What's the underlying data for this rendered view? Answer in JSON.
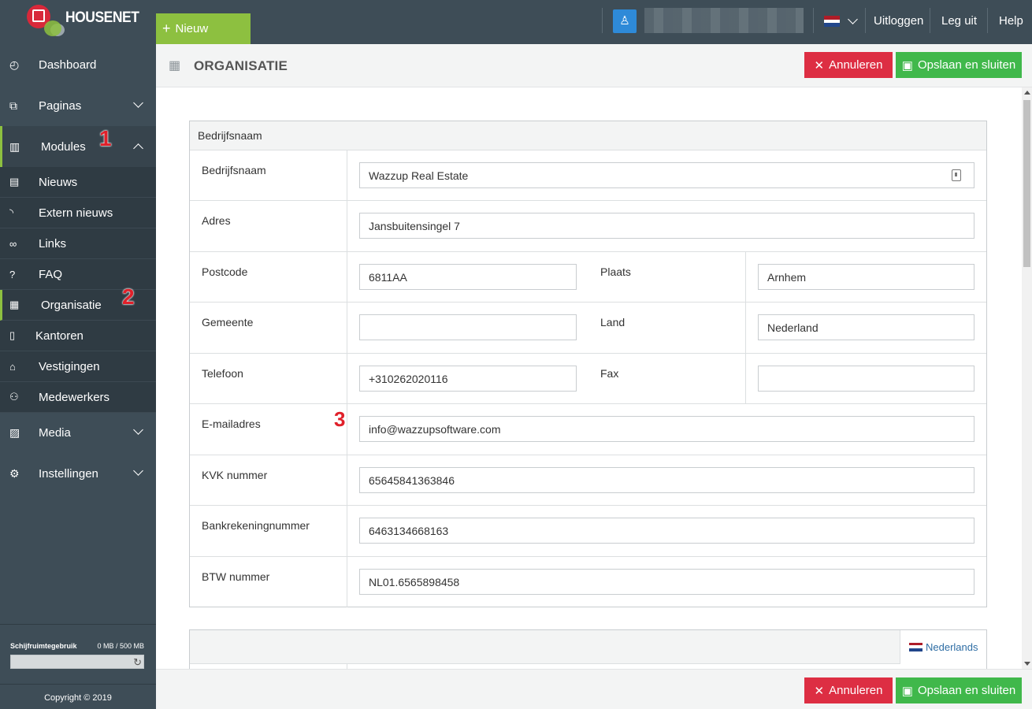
{
  "brand": {
    "name": "HOUSENET"
  },
  "topbar": {
    "new_label": "Nieuw",
    "links": [
      "Uitloggen",
      "Leg uit",
      "Help"
    ]
  },
  "sidebar": {
    "items": [
      {
        "label": "Dashboard",
        "icon": "dashboard-icon"
      },
      {
        "label": "Paginas",
        "icon": "sitemap-icon"
      },
      {
        "label": "Modules",
        "icon": "columns-icon"
      }
    ],
    "subitems": [
      {
        "label": "Nieuws",
        "icon": "newspaper-icon"
      },
      {
        "label": "Extern nieuws",
        "icon": "rss-icon"
      },
      {
        "label": "Links",
        "icon": "link-icon"
      },
      {
        "label": "FAQ",
        "icon": "question-icon"
      },
      {
        "label": "Organisatie",
        "icon": "city-icon"
      },
      {
        "label": "Kantoren",
        "icon": "building-icon"
      },
      {
        "label": "Vestigingen",
        "icon": "home-icon"
      },
      {
        "label": "Medewerkers",
        "icon": "users-icon"
      }
    ],
    "bottom_items": [
      {
        "label": "Media",
        "icon": "image-icon"
      },
      {
        "label": "Instellingen",
        "icon": "cogs-icon"
      }
    ],
    "markers": [
      "1",
      "2"
    ],
    "disk": {
      "label": "Schijfruimtegebruik",
      "value": "0 MB / 500 MB"
    },
    "copyright": "Copyright © 2019"
  },
  "page": {
    "title": "ORGANISATIE",
    "cancel_label": "Annuleren",
    "save_label": "Opslaan en sluiten",
    "marker3": "3"
  },
  "form": {
    "section_title": "Bedrijfsnaam",
    "bedrijfsnaam": {
      "label": "Bedrijfsnaam",
      "value": "Wazzup Real Estate"
    },
    "adres": {
      "label": "Adres",
      "value": "Jansbuitensingel 7"
    },
    "postcode": {
      "label": "Postcode",
      "value": "6811AA"
    },
    "plaats": {
      "label": "Plaats",
      "value": "Arnhem"
    },
    "gemeente": {
      "label": "Gemeente",
      "value": ""
    },
    "land": {
      "label": "Land",
      "value": "Nederland"
    },
    "telefoon": {
      "label": "Telefoon",
      "value": "+310262020116"
    },
    "fax": {
      "label": "Fax",
      "value": ""
    },
    "email": {
      "label": "E-mailadres",
      "value": "info@wazzupsoftware.com"
    },
    "kvk": {
      "label": "KVK nummer",
      "value": "65645841363846"
    },
    "bank": {
      "label": "Bankrekeningnummer",
      "value": "6463134668163"
    },
    "btw": {
      "label": "BTW nummer",
      "value": "NL01.6565898458"
    }
  },
  "section2": {
    "language_label": "Nederlands"
  },
  "colors": {
    "accent_green": "#8dc040",
    "danger": "#dd2e43",
    "success": "#40b84b",
    "sidebar": "#3e4d57"
  }
}
